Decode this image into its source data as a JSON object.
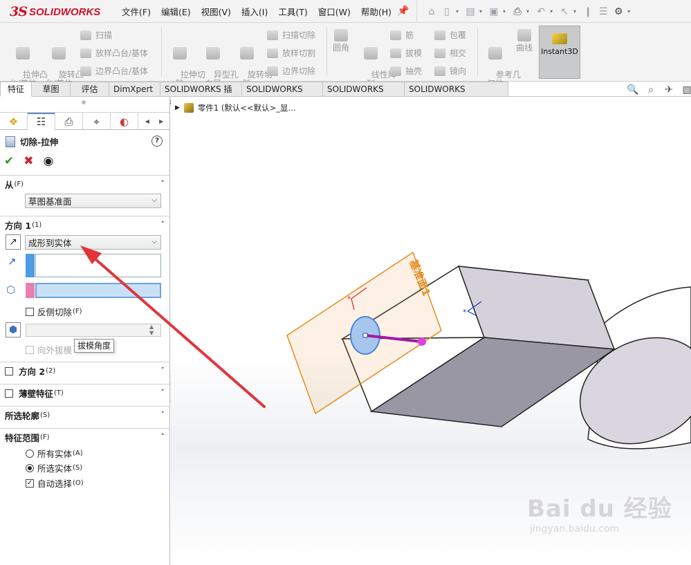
{
  "app": {
    "brand_ds": "3S",
    "brand_name": "SOLIDWORKS"
  },
  "menu": {
    "items": [
      "文件(F)",
      "编辑(E)",
      "视图(V)",
      "插入(I)",
      "工具(T)",
      "窗口(W)",
      "帮助(H)"
    ]
  },
  "ribbon": {
    "extrude_boss": "拉伸凸\n台/基体",
    "revolve_boss": "旋转凸\n台/基体",
    "sweep": "扫描",
    "loft_boss": "放样凸台/基体",
    "boundary_boss": "边界凸台/基体",
    "extrude_cut": "拉伸切\n除",
    "hole_wizard": "异型孔\n向导",
    "revolve_cut": "旋转切\n除",
    "sweep_cut": "扫描切除",
    "loft_cut": "放样切割",
    "boundary_cut": "边界切除",
    "fillet": "圆角",
    "linear_pattern": "线性阵\n列",
    "rib": "筋",
    "draft": "拔模",
    "shell": "抽壳",
    "wrap": "包覆",
    "intersect": "相交",
    "mirror": "镜向",
    "ref_geometry": "参考几\n何体",
    "curves": "曲线",
    "instant3d": "Instant3D"
  },
  "tabs": [
    "特征",
    "草图",
    "评估",
    "DimXpert",
    "SOLIDWORKS 插件",
    "SOLIDWORKS MBD",
    "SOLIDWORKS CAM",
    "SOLIDWORKS Inspection"
  ],
  "panel": {
    "title": "切除-拉伸",
    "from": {
      "label": "从",
      "sub": "(F)",
      "value": "草图基准面"
    },
    "direction1": {
      "label": "方向 1",
      "sub": "(1)",
      "end_condition": "成形到实体",
      "flip_label": "反侧切除",
      "flip_sub": "(F)",
      "draft_outward": "向外拔模",
      "tooltip": "拔模角度"
    },
    "direction2": {
      "label": "方向 2",
      "sub": "(2)"
    },
    "thin_feature": {
      "label": "薄壁特征",
      "sub": "(T)"
    },
    "selected_contours": {
      "label": "所选轮廓",
      "sub": "(S)"
    },
    "feature_scope": {
      "label": "特征范围",
      "sub": "(F)",
      "all_bodies": "所有实体",
      "all_bodies_sub": "(A)",
      "selected_bodies": "所选实体",
      "selected_bodies_sub": "(S)",
      "auto_select": "自动选择",
      "auto_select_sub": "(O)",
      "selected": "selected_bodies",
      "auto_select_checked": true
    }
  },
  "tree": {
    "text": "零件1  (默认<<默认>_显..."
  },
  "graphics": {
    "plane_label": "基准面1"
  },
  "watermark": {
    "main": "Bai du 经验",
    "url": "jingyan.baidu.com"
  },
  "colors": {
    "brand": "#d0102a",
    "annotation_arrow": "#e0353b",
    "plane": "#e98a1d",
    "sketch_line": "#a01aa8"
  }
}
